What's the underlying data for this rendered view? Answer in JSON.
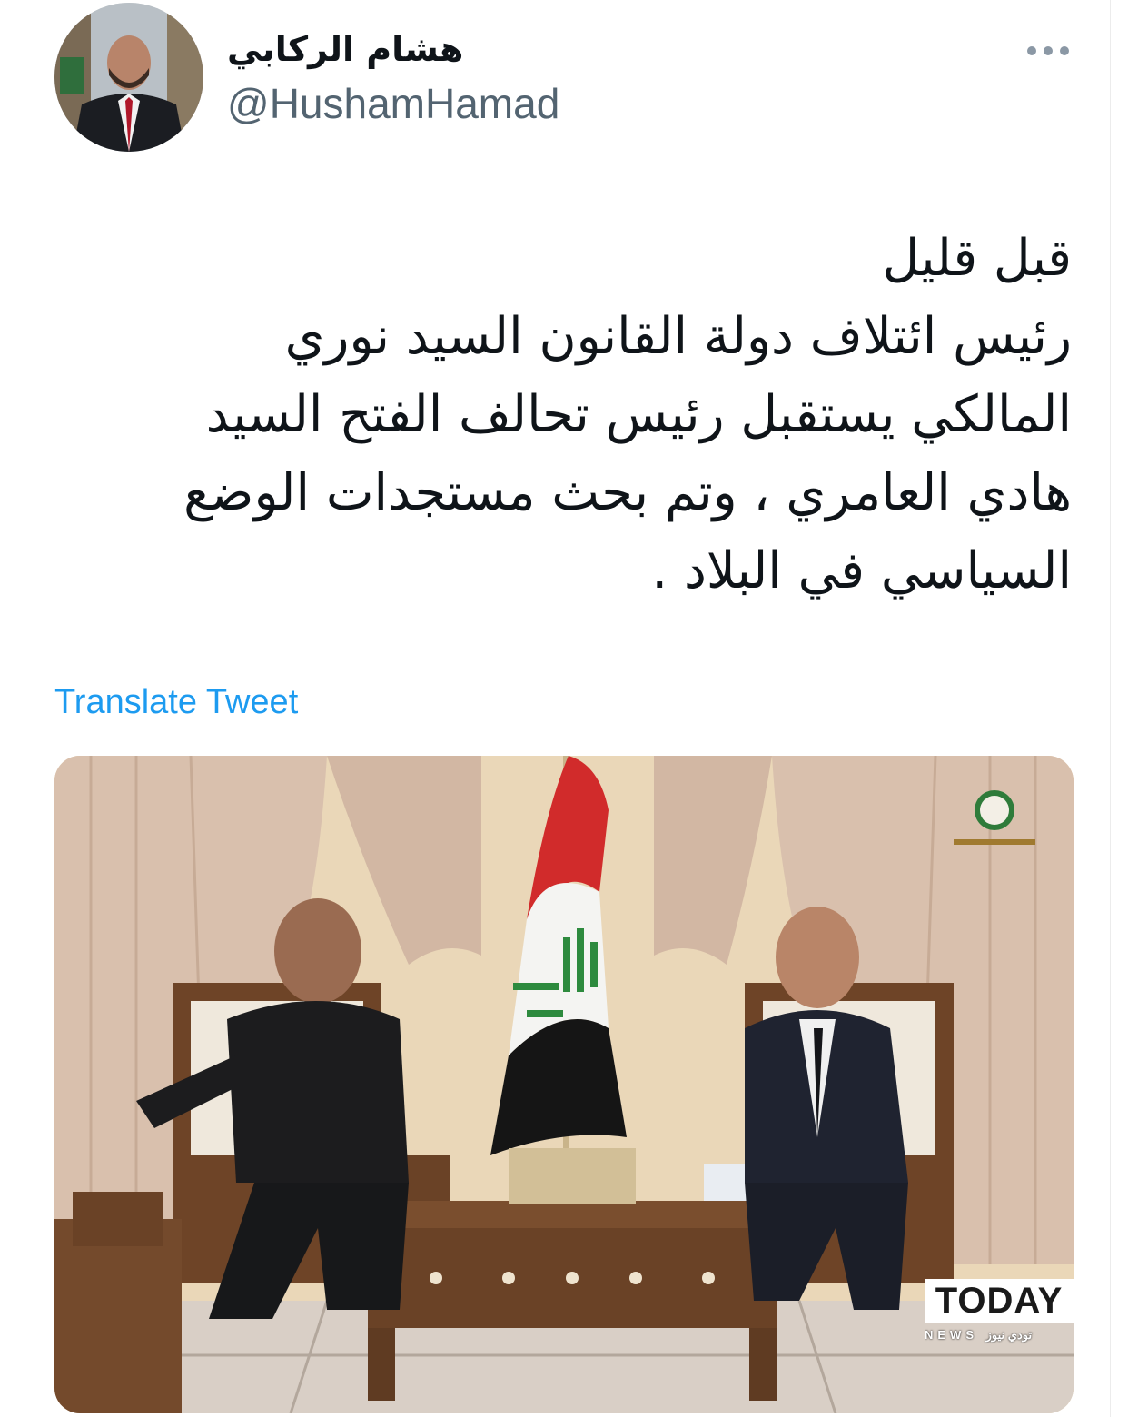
{
  "author": {
    "display_name": "هشام الركابي",
    "handle": "@HushamHamad"
  },
  "more_icon": "more-horizontal-icon",
  "tweet": {
    "lines": [
      "قبل قليل",
      "رئيس ائتلاف دولة القانون السيد نوري",
      "المالكي يستقبل رئيس تحالف الفتح السيد",
      "هادي العامري ، وتم بحث مستجدات الوضع",
      "السياسي في البلاد ."
    ]
  },
  "translate_label": "Translate Tweet",
  "media": {
    "watermark_logo": "TODAY",
    "watermark_sub": "NEWS تودي نيوز"
  },
  "colors": {
    "text": "#0f1419",
    "secondary": "#536471",
    "link": "#1d9bf0"
  }
}
